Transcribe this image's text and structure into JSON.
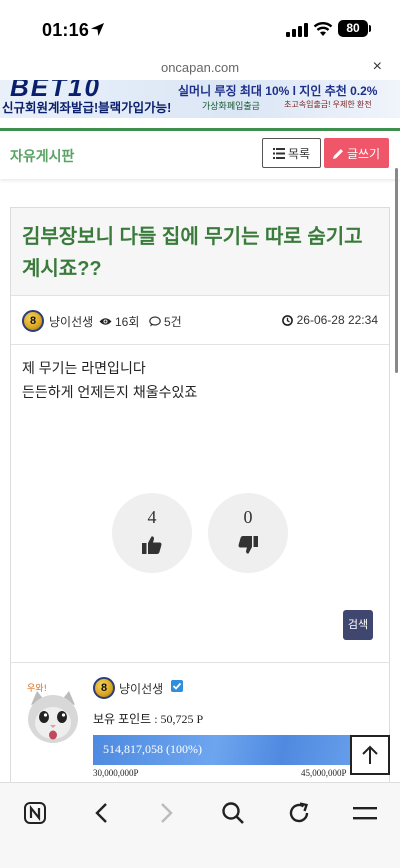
{
  "status": {
    "time": "01:16",
    "battery": "80"
  },
  "browser": {
    "url": "oncapan.com",
    "close": "×"
  },
  "banner": {
    "logo": "BET10",
    "line1": "실머니 루징 최대 10% l 지인 추천 0.2%",
    "line2": "신규회원계좌발급!블랙가입가능!",
    "line2b": "가상화폐입출금",
    "line2c": "초고속입출금! 우제한 환전"
  },
  "board": {
    "title": "자유게시판",
    "list_label": "목록",
    "write_label": "글쓰기"
  },
  "post": {
    "title": "김부장보니 다들 집에 무기는 따로 숨기고 계시죠??",
    "author": "냥이선생",
    "level": "8",
    "views": "16회",
    "comments": "5건",
    "date": "26-06-28 22:34",
    "body": [
      "제 무기는 라면입니다",
      "든든하게 언제든지 채울수있죠"
    ],
    "upvotes": "4",
    "downvotes": "0",
    "search_label": "검색"
  },
  "profile": {
    "name": "냥이선생",
    "level": "8",
    "points": "보유 포인트 : 50,725 P",
    "progress": 1.0,
    "exp_text": "514,817,058 (100%)",
    "exp_min": "30,000,000P",
    "exp_max": "45,000,000P",
    "avatar_caption": "우와!"
  },
  "colors": {
    "accent_green": "#3a7b3c",
    "write_button": "#f0566a",
    "search_button": "#3f466f",
    "exp_bar": "#4e8ae0"
  },
  "icons": [
    "location-arrow-icon",
    "signal-icon",
    "wifi-icon",
    "battery-icon",
    "list-icon",
    "pencil-icon",
    "eye-icon",
    "comment-icon",
    "clock-icon",
    "thumbs-up-icon",
    "thumbs-down-icon",
    "verified-icon",
    "arrow-up-icon",
    "naver-icon",
    "back-icon",
    "forward-icon",
    "search-icon",
    "reload-icon",
    "menu-icon"
  ]
}
